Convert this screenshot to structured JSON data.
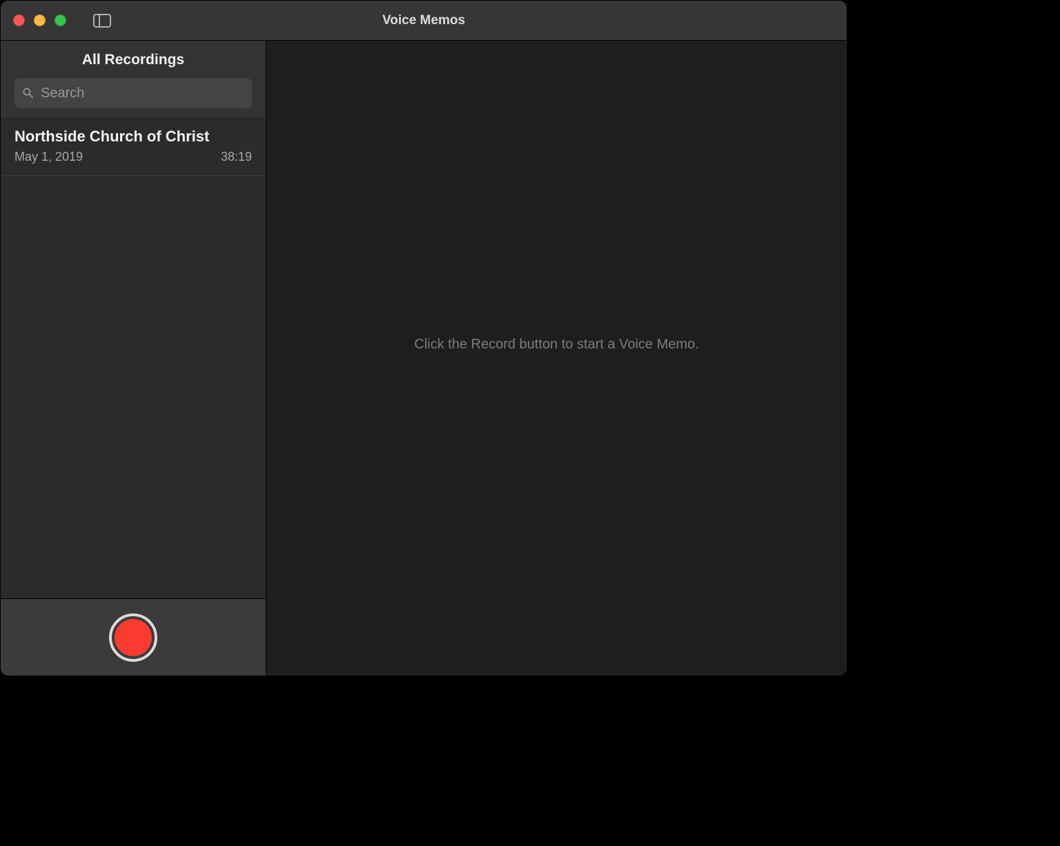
{
  "window": {
    "title": "Voice Memos"
  },
  "sidebar": {
    "header": "All Recordings",
    "search_placeholder": "Search",
    "recordings": [
      {
        "title": "Northside Church of Christ",
        "date": "May 1, 2019",
        "duration": "38:19"
      }
    ]
  },
  "main": {
    "empty_message": "Click the Record button to start a Voice Memo."
  },
  "colors": {
    "record_red": "#fc3b30",
    "sidebar_bg": "#333333",
    "list_bg": "#2b2b2b",
    "main_bg": "#1e1e1e"
  }
}
